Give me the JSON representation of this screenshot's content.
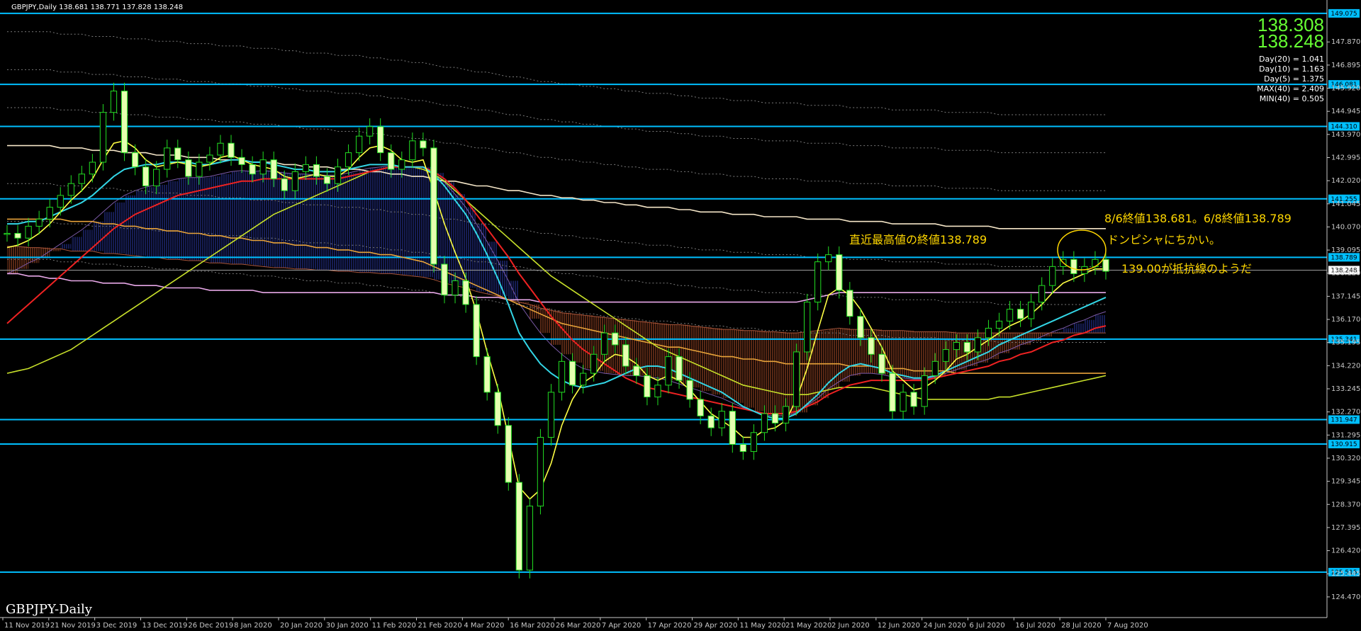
{
  "header": {
    "symbol_info": "GBPJPY,Daily  138.681 138.771 137.828 138.248",
    "corner_label": "GBPJPY-Daily"
  },
  "quote": {
    "price1": "138.308",
    "price2": "138.248"
  },
  "stats": [
    "Day(20) = 1.041",
    "Day(10) = 1.163",
    "Day(5) = 1.375",
    "MAX(40) = 2.409",
    "MIN(40) = 0.505"
  ],
  "annotations": {
    "recent_high": "直近最高値の終値138.789",
    "close_note": "8/6終値138.681。6/8終値138.789",
    "dompisha": "ドンピシャにちかい。",
    "resistance": "139.00が抵抗線のようだ"
  },
  "colors": {
    "background": "#000000",
    "candle": "#22dd22",
    "level_line": "#00bfff",
    "annotation": "#ffd700",
    "price_text": "#66ff33"
  },
  "chart_data": {
    "type": "candlestick",
    "x_labels": [
      "11 Nov 2019",
      "21 Nov 2019",
      "3 Dec 2019",
      "13 Dec 2019",
      "26 Dec 2019",
      "8 Jan 2020",
      "20 Jan 2020",
      "30 Jan 2020",
      "11 Feb 2020",
      "21 Feb 2020",
      "4 Mar 2020",
      "16 Mar 2020",
      "26 Mar 2020",
      "7 Apr 2020",
      "17 Apr 2020",
      "29 Apr 2020",
      "11 May 2020",
      "21 May 2020",
      "2 Jun 2020",
      "12 Jun 2020",
      "24 Jun 2020",
      "6 Jul 2020",
      "16 Jul 2020",
      "28 Jul 2020",
      "7 Aug 2020"
    ],
    "y_ticks": [
      "147.870",
      "146.895",
      "145.920",
      "144.945",
      "143.970",
      "142.995",
      "142.020",
      "141.045",
      "140.070",
      "139.095",
      "138.120",
      "137.145",
      "136.170",
      "135.195",
      "134.220",
      "133.245",
      "132.270",
      "131.295",
      "130.320",
      "129.345",
      "128.370",
      "127.395",
      "126.420",
      "125.445",
      "124.470"
    ],
    "ylim": [
      123.6,
      149.4
    ],
    "levels": [
      {
        "value": 149.075,
        "label": "149.075"
      },
      {
        "value": 146.081,
        "label": "146.081"
      },
      {
        "value": 144.31,
        "label": "144.310"
      },
      {
        "value": 141.255,
        "label": "141.255"
      },
      {
        "value": 138.789,
        "label": "138.789"
      },
      {
        "value": 135.341,
        "label": "135.341"
      },
      {
        "value": 131.947,
        "label": "131.947"
      },
      {
        "value": 130.915,
        "label": "130.915"
      },
      {
        "value": 125.515,
        "label": "125.515"
      }
    ],
    "current_price": {
      "value": 138.248,
      "label": "138.248"
    },
    "close": [
      139.8,
      139.6,
      140.1,
      140.4,
      140.9,
      141.4,
      141.9,
      142.3,
      142.8,
      144.9,
      145.8,
      143.2,
      142.6,
      141.8,
      142.5,
      143.4,
      142.9,
      142.2,
      142.8,
      143.1,
      143.6,
      143.0,
      142.7,
      142.3,
      142.9,
      142.1,
      141.6,
      142.4,
      142.7,
      142.2,
      141.9,
      142.6,
      143.2,
      143.9,
      144.3,
      143.2,
      142.5,
      142.9,
      143.7,
      143.4,
      138.5,
      137.2,
      137.8,
      136.8,
      134.6,
      133.1,
      131.7,
      129.3,
      125.6,
      128.3,
      131.2,
      133.1,
      134.4,
      133.4,
      133.9,
      134.7,
      135.6,
      135.1,
      134.2,
      133.8,
      132.9,
      133.4,
      134.6,
      133.6,
      132.8,
      132.1,
      131.6,
      132.3,
      130.9,
      130.6,
      131.4,
      132.2,
      131.8,
      132.5,
      134.8,
      136.9,
      138.6,
      138.9,
      137.4,
      136.3,
      135.4,
      134.7,
      133.9,
      132.3,
      133.1,
      132.5,
      133.8,
      134.4,
      134.9,
      135.2,
      134.8,
      135.4,
      135.8,
      136.1,
      136.6,
      136.2,
      136.9,
      137.6,
      138.4,
      138.7,
      138.1,
      138.4,
      138.7,
      138.2
    ],
    "ma_yellow": [
      139.2,
      139.3,
      139.5,
      139.8,
      140.2,
      140.7,
      141.2,
      141.6,
      142.1,
      142.9,
      143.6,
      143.7,
      143.4,
      142.9,
      142.6,
      142.7,
      142.8,
      142.7,
      142.6,
      142.7,
      143.0,
      143.1,
      142.9,
      142.7,
      142.6,
      142.5,
      142.2,
      142.1,
      142.2,
      142.3,
      142.2,
      142.2,
      142.5,
      143.0,
      143.4,
      143.5,
      143.3,
      142.9,
      142.8,
      142.9,
      141.6,
      140.2,
      139.0,
      137.9,
      136.5,
      134.8,
      133.3,
      131.2,
      129.1,
      128.6,
      129.0,
      130.1,
      131.7,
      132.8,
      133.5,
      133.8,
      134.4,
      134.7,
      134.6,
      134.3,
      133.8,
      133.6,
      133.8,
      133.6,
      133.2,
      132.7,
      132.2,
      131.9,
      131.6,
      131.2,
      131.2,
      131.5,
      131.6,
      131.9,
      132.8,
      134.1,
      135.7,
      137.2,
      137.5,
      137.2,
      136.6,
      135.8,
      135.0,
      134.0,
      133.6,
      133.2,
      133.3,
      133.6,
      134.0,
      134.5,
      134.7,
      135.0,
      135.3,
      135.6,
      135.9,
      136.1,
      136.4,
      136.8,
      137.3,
      137.7,
      137.9,
      138.1,
      138.3,
      138.3
    ],
    "ma_cyan": [
      140.2,
      140.2,
      140.3,
      140.3,
      140.5,
      140.7,
      140.9,
      141.1,
      141.4,
      141.8,
      142.2,
      142.5,
      142.6,
      142.7,
      142.7,
      142.8,
      142.8,
      142.8,
      142.7,
      142.7,
      142.8,
      142.9,
      142.9,
      142.8,
      142.8,
      142.7,
      142.6,
      142.5,
      142.5,
      142.4,
      142.4,
      142.4,
      142.5,
      142.6,
      142.7,
      142.7,
      142.7,
      142.6,
      142.6,
      142.6,
      142.3,
      141.8,
      141.2,
      140.6,
      139.8,
      138.9,
      137.9,
      136.8,
      135.6,
      134.9,
      134.3,
      133.9,
      133.6,
      133.4,
      133.3,
      133.4,
      133.5,
      133.7,
      133.9,
      134.1,
      134.2,
      134.2,
      134.1,
      133.9,
      133.7,
      133.5,
      133.3,
      133.1,
      132.8,
      132.5,
      132.3,
      132.1,
      132.0,
      132.0,
      132.2,
      132.6,
      133.0,
      133.5,
      133.9,
      134.2,
      134.3,
      134.2,
      134.1,
      133.9,
      133.8,
      133.7,
      133.7,
      133.8,
      134.0,
      134.2,
      134.4,
      134.6,
      134.8,
      135.1,
      135.3,
      135.5,
      135.7,
      135.9,
      136.1,
      136.3,
      136.5,
      136.7,
      136.9,
      137.1
    ],
    "ma_red": [
      136.0,
      136.4,
      136.8,
      137.2,
      137.6,
      138.0,
      138.4,
      138.8,
      139.2,
      139.6,
      140.0,
      140.3,
      140.6,
      140.8,
      141.0,
      141.2,
      141.4,
      141.5,
      141.6,
      141.7,
      141.8,
      141.9,
      142.0,
      142.0,
      142.1,
      142.1,
      142.1,
      142.1,
      142.1,
      142.1,
      142.1,
      142.1,
      142.2,
      142.3,
      142.4,
      142.5,
      142.6,
      142.6,
      142.6,
      142.6,
      142.4,
      142.1,
      141.7,
      141.2,
      140.6,
      140.0,
      139.4,
      138.8,
      138.1,
      137.5,
      136.9,
      136.3,
      135.8,
      135.3,
      134.9,
      134.6,
      134.3,
      134.0,
      133.7,
      133.5,
      133.3,
      133.2,
      133.1,
      133.0,
      132.9,
      132.8,
      132.7,
      132.6,
      132.5,
      132.4,
      132.3,
      132.2,
      132.2,
      132.2,
      132.3,
      132.5,
      132.7,
      133.0,
      133.2,
      133.4,
      133.5,
      133.6,
      133.6,
      133.6,
      133.6,
      133.6,
      133.6,
      133.7,
      133.8,
      133.9,
      134.0,
      134.1,
      134.2,
      134.4,
      134.5,
      134.7,
      134.8,
      135.0,
      135.2,
      135.3,
      135.5,
      135.6,
      135.8,
      135.9
    ],
    "ma_lime": [
      133.9,
      134.0,
      134.1,
      134.3,
      134.5,
      134.7,
      134.9,
      135.2,
      135.5,
      135.8,
      136.1,
      136.4,
      136.7,
      137.0,
      137.3,
      137.6,
      137.9,
      138.2,
      138.5,
      138.8,
      139.1,
      139.4,
      139.7,
      140.0,
      140.3,
      140.6,
      140.8,
      141.0,
      141.2,
      141.4,
      141.6,
      141.8,
      142.0,
      142.2,
      142.4,
      142.5,
      142.6,
      142.6,
      142.6,
      142.5,
      142.3,
      142.0,
      141.6,
      141.2,
      140.8,
      140.4,
      140.0,
      139.6,
      139.2,
      138.8,
      138.4,
      138.0,
      137.7,
      137.4,
      137.1,
      136.8,
      136.5,
      136.2,
      135.9,
      135.6,
      135.3,
      135.0,
      134.8,
      134.6,
      134.4,
      134.2,
      134.0,
      133.8,
      133.6,
      133.4,
      133.3,
      133.2,
      133.1,
      133.0,
      133.0,
      133.0,
      133.1,
      133.2,
      133.3,
      133.3,
      133.3,
      133.3,
      133.2,
      133.1,
      133.0,
      132.9,
      132.8,
      132.8,
      132.8,
      132.8,
      132.8,
      132.8,
      132.8,
      132.9,
      132.9,
      133.0,
      133.1,
      133.2,
      133.3,
      133.4,
      133.5,
      133.6,
      133.7,
      133.8
    ],
    "ma_orange": [
      140.4,
      140.4,
      140.4,
      140.4,
      140.4,
      140.4,
      140.3,
      140.3,
      140.3,
      140.2,
      140.2,
      140.1,
      140.1,
      140.0,
      140.0,
      139.9,
      139.9,
      139.8,
      139.8,
      139.7,
      139.7,
      139.6,
      139.6,
      139.5,
      139.5,
      139.4,
      139.4,
      139.3,
      139.3,
      139.2,
      139.2,
      139.1,
      139.1,
      139.0,
      139.0,
      138.9,
      138.9,
      138.8,
      138.7,
      138.6,
      138.4,
      138.2,
      138.0,
      137.8,
      137.6,
      137.4,
      137.2,
      137.0,
      136.8,
      136.6,
      136.4,
      136.2,
      136.0,
      135.9,
      135.8,
      135.7,
      135.6,
      135.5,
      135.4,
      135.3,
      135.2,
      135.1,
      135.0,
      135.0,
      134.9,
      134.8,
      134.7,
      134.6,
      134.6,
      134.5,
      134.5,
      134.4,
      134.4,
      134.3,
      134.3,
      134.3,
      134.3,
      134.3,
      134.3,
      134.2,
      134.2,
      134.2,
      134.1,
      134.1,
      134.1,
      134.0,
      134.0,
      134.0,
      134.0,
      133.9,
      133.9,
      133.9,
      133.9,
      133.9,
      133.9,
      133.9,
      133.9,
      133.9,
      133.9,
      133.9,
      133.9,
      133.9,
      133.9,
      133.9
    ],
    "ma_pink": [
      138.1,
      138.1,
      138.0,
      138.0,
      137.9,
      137.9,
      137.8,
      137.8,
      137.8,
      137.7,
      137.7,
      137.7,
      137.6,
      137.6,
      137.6,
      137.5,
      137.5,
      137.5,
      137.5,
      137.4,
      137.4,
      137.4,
      137.4,
      137.4,
      137.3,
      137.3,
      137.3,
      137.3,
      137.3,
      137.3,
      137.3,
      137.3,
      137.3,
      137.3,
      137.3,
      137.3,
      137.3,
      137.3,
      137.3,
      137.3,
      137.3,
      137.2,
      137.2,
      137.2,
      137.1,
      137.1,
      137.1,
      137.0,
      137.0,
      137.0,
      136.9,
      136.9,
      136.9,
      136.9,
      136.9,
      136.9,
      136.9,
      136.9,
      136.9,
      136.9,
      136.9,
      136.9,
      136.9,
      136.9,
      136.9,
      136.9,
      136.9,
      136.9,
      136.9,
      136.9,
      136.9,
      136.9,
      136.9,
      136.9,
      136.9,
      137.0,
      137.1,
      137.2,
      137.3,
      137.3,
      137.3,
      137.3,
      137.3,
      137.3,
      137.3,
      137.3,
      137.3,
      137.3,
      137.3,
      137.3,
      137.3,
      137.3,
      137.3,
      137.3,
      137.3,
      137.3,
      137.3,
      137.3,
      137.3,
      137.3,
      137.3,
      137.3,
      137.3,
      137.3
    ],
    "ma_white": [
      143.5,
      143.5,
      143.5,
      143.5,
      143.5,
      143.4,
      143.4,
      143.4,
      143.3,
      143.3,
      143.3,
      143.2,
      143.2,
      143.2,
      143.1,
      143.1,
      143.1,
      143.0,
      143.0,
      143.0,
      142.9,
      142.9,
      142.9,
      142.8,
      142.8,
      142.8,
      142.7,
      142.7,
      142.6,
      142.6,
      142.6,
      142.5,
      142.5,
      142.5,
      142.4,
      142.4,
      142.3,
      142.3,
      142.2,
      142.2,
      142.1,
      142.0,
      142.0,
      141.9,
      141.8,
      141.8,
      141.7,
      141.6,
      141.6,
      141.5,
      141.4,
      141.4,
      141.3,
      141.3,
      141.2,
      141.2,
      141.1,
      141.1,
      141.0,
      141.0,
      140.9,
      140.9,
      140.9,
      140.8,
      140.8,
      140.7,
      140.7,
      140.7,
      140.6,
      140.6,
      140.6,
      140.5,
      140.5,
      140.5,
      140.5,
      140.4,
      140.4,
      140.4,
      140.4,
      140.3,
      140.3,
      140.3,
      140.3,
      140.2,
      140.2,
      140.2,
      140.2,
      140.2,
      140.1,
      140.1,
      140.1,
      140.1,
      140.1,
      140.0,
      140.0,
      140.0,
      140.0,
      140.0,
      140.0,
      140.0,
      140.0,
      140.0,
      140.0,
      140.0
    ]
  }
}
